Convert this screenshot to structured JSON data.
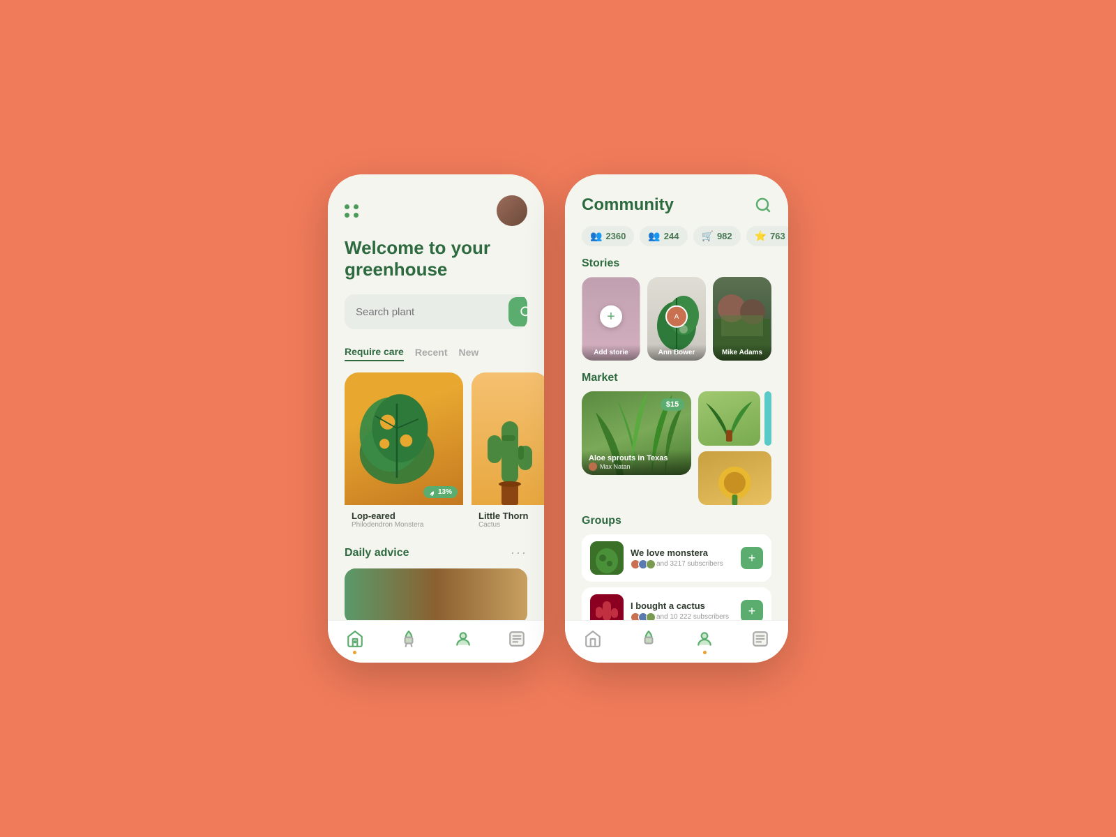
{
  "background": "#F07B5A",
  "phones": {
    "left": {
      "header": {
        "dots": "⋮⋮",
        "avatar_alt": "User avatar"
      },
      "welcome": {
        "title": "Welcome to your greenhouse"
      },
      "search": {
        "placeholder": "Search plant",
        "button_label": "Search"
      },
      "tabs": [
        {
          "label": "Require care",
          "active": true
        },
        {
          "label": "Recent",
          "active": false
        },
        {
          "label": "New",
          "active": false
        }
      ],
      "plants": [
        {
          "name": "Lop-eared",
          "species": "Philodendron Monstera",
          "health": "13%",
          "size": "large"
        },
        {
          "name": "Little Thorn",
          "species": "Cactus",
          "size": "small"
        }
      ],
      "daily_advice": {
        "title": "Daily advice",
        "more": "..."
      },
      "nav": [
        {
          "icon": "home-plant",
          "active": true,
          "label": "Home"
        },
        {
          "icon": "pot-plant",
          "active": false,
          "label": "Plants"
        },
        {
          "icon": "profile",
          "active": false,
          "label": "Profile"
        },
        {
          "icon": "encyclopedia",
          "active": false,
          "label": "Encyclopedia"
        }
      ]
    },
    "right": {
      "header": {
        "title": "Community",
        "search_label": "Search"
      },
      "stats": [
        {
          "icon": "👥",
          "value": "2360"
        },
        {
          "icon": "👥",
          "value": "244"
        },
        {
          "icon": "🛒",
          "value": "982"
        },
        {
          "icon": "⭐",
          "value": "763"
        }
      ],
      "stories": {
        "title": "Stories",
        "items": [
          {
            "type": "add",
            "label": "Add storie"
          },
          {
            "name": "Ann Bower"
          },
          {
            "name": "Mike Adams"
          }
        ]
      },
      "market": {
        "title": "Market",
        "featured": {
          "name": "Aloe sprouts in Texas",
          "seller": "Max Natan",
          "price": "$15"
        }
      },
      "groups": {
        "title": "Groups",
        "items": [
          {
            "name": "We love monstera",
            "subscribers": "and 3217 subscribers",
            "type": "monstera"
          },
          {
            "name": "I bought a cactus",
            "subscribers": "and 10 222 subscribers",
            "type": "cactus"
          }
        ]
      },
      "nav": [
        {
          "icon": "home-plant",
          "active": false,
          "label": "Home"
        },
        {
          "icon": "pot-plant",
          "active": false,
          "label": "Plants"
        },
        {
          "icon": "profile",
          "active": true,
          "label": "Profile"
        },
        {
          "icon": "encyclopedia",
          "active": false,
          "label": "Encyclopedia"
        }
      ]
    }
  }
}
